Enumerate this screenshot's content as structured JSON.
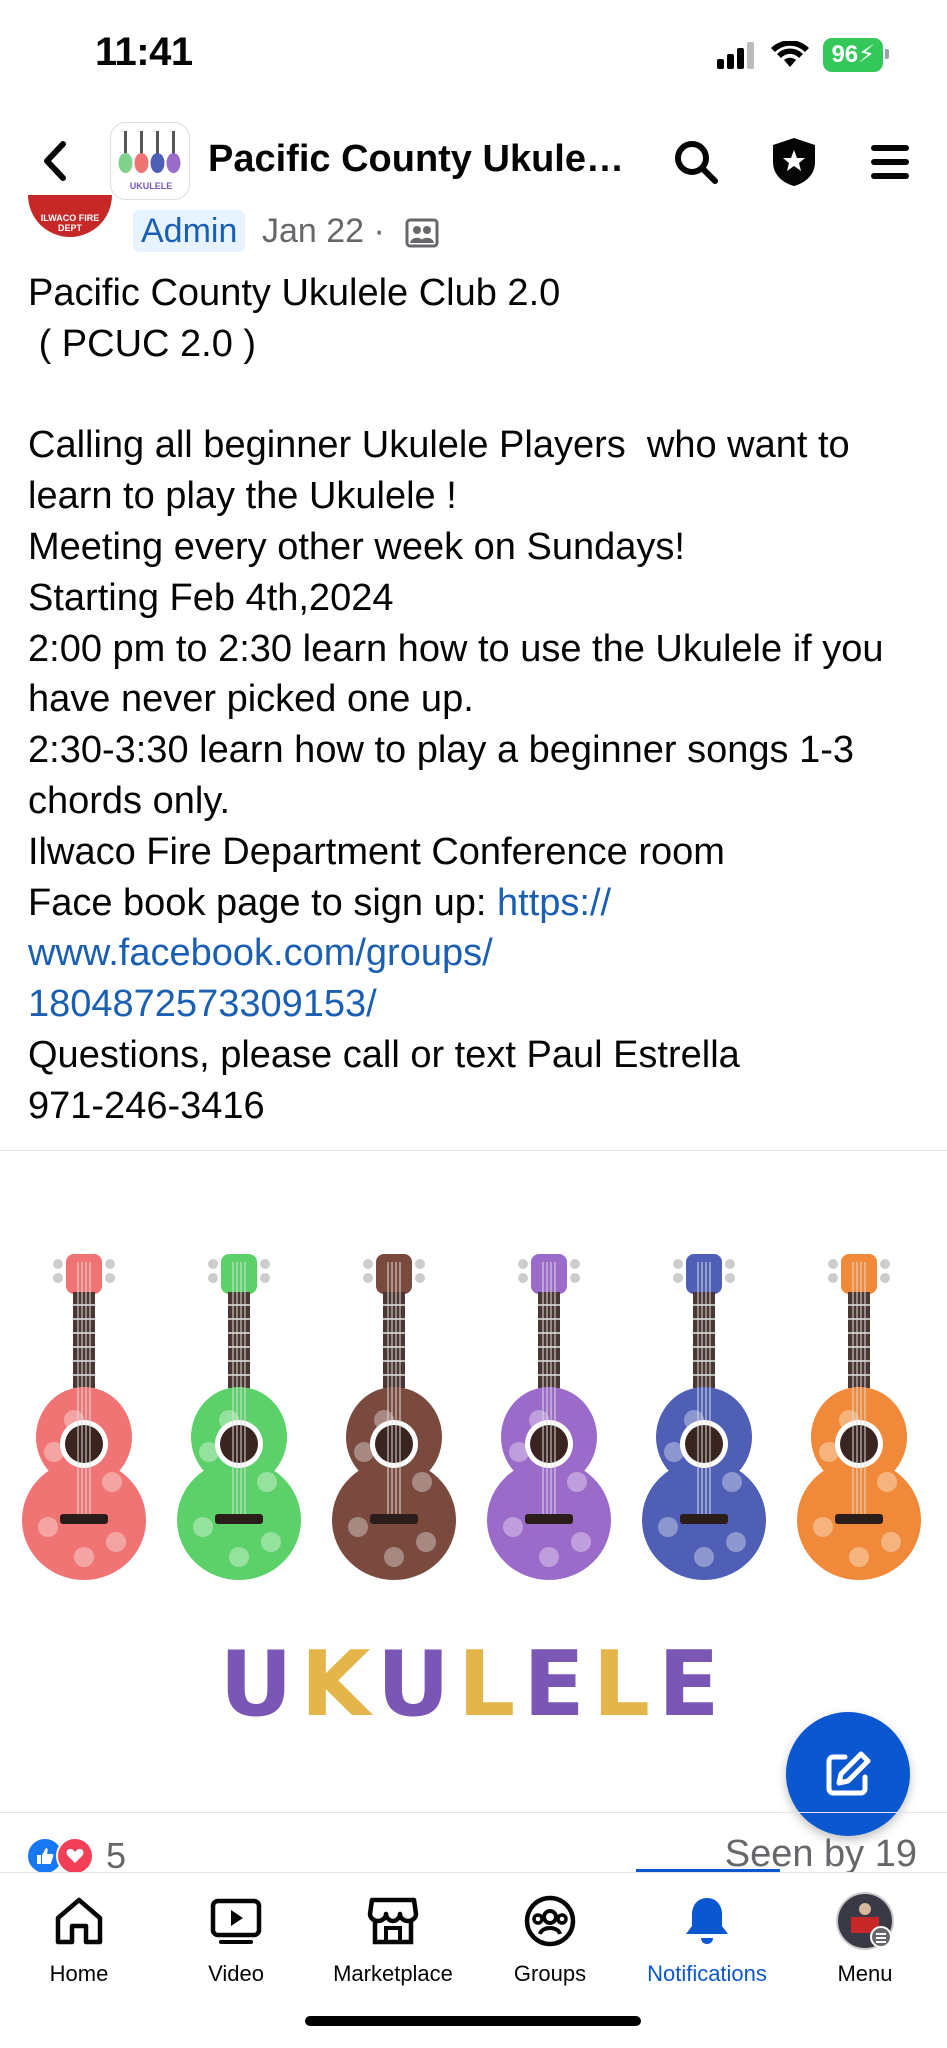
{
  "status_bar": {
    "time": "11:41",
    "battery": "96"
  },
  "header": {
    "title": "Pacific County Ukulel...",
    "avatar_caption": "UKULELE"
  },
  "post": {
    "author_avatar_text": "ILWACO FIRE DEPT",
    "badge": "Admin",
    "date": "Jan 22 ·",
    "lines_before_link": "Pacific County Ukulele Club 2.0\n ( PCUC 2.0 )\n\nCalling all beginner Ukulele Players  who want to learn to play the Ukulele !\nMeeting every other week on Sundays!\nStarting Feb 4th,2024\n2:00 pm to 2:30 learn how to use the Ukulele if you have never picked one up.\n2:30-3:30 learn how to play a beginner songs 1-3 chords only.\nIlwaco Fire Department Conference room\nFace book page to sign up: ",
    "link": "https://\nwww.facebook.com/groups/\n1804872573309153/",
    "lines_after_link": "\nQuestions, please call or text Paul Estrella\n971-246-3416"
  },
  "image": {
    "word": "UKULELE",
    "ukulele_colors": [
      "#f07474",
      "#5cd16a",
      "#7a4a3f",
      "#9b6bc9",
      "#4f5fb5",
      "#f08a3a"
    ]
  },
  "reactions": {
    "count": "5",
    "seen_by": "Seen by 19"
  },
  "nav": [
    {
      "label": "Home",
      "icon": "home-icon"
    },
    {
      "label": "Video",
      "icon": "video-icon"
    },
    {
      "label": "Marketplace",
      "icon": "marketplace-icon"
    },
    {
      "label": "Groups",
      "icon": "groups-icon"
    },
    {
      "label": "Notifications",
      "icon": "bell-icon"
    },
    {
      "label": "Menu",
      "icon": "profile-menu-icon"
    }
  ],
  "colors": {
    "accent": "#0b57d0",
    "link": "#1b5fb4",
    "battery": "#34c759"
  }
}
